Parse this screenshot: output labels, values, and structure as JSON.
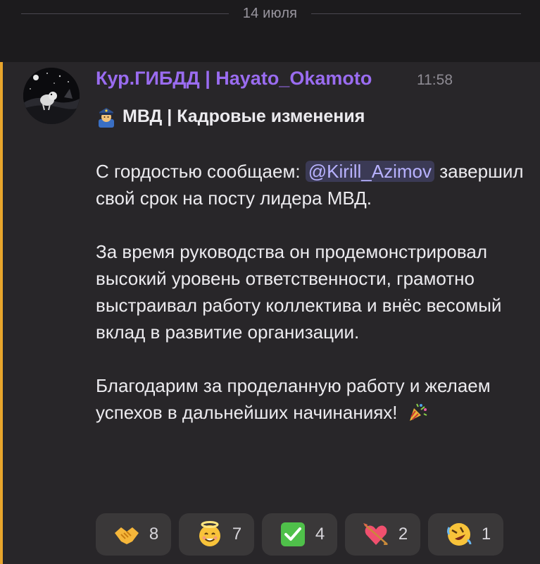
{
  "date_separator": "14 июля",
  "message": {
    "author": "Кур.ГИБДД | Hayato_Okamoto",
    "time": "11:58",
    "title": "МВД | Кадровые изменения",
    "title_icon": "police-officer-emoji",
    "p1_before": "С гордостью сообщаем: ",
    "mention": "@Kirill_Azimov",
    "p1_after": " завершил свой срок на посту лидера МВД.",
    "p2": "За время руководства он продемонстрировал высокий уровень ответственности, грамотно выстраивал работу коллектива и внёс весомый вклад в развитие организации.",
    "p3": "Благодарим за проделанную работу и желаем успехов в дальнейших начинаниях!",
    "p3_icon": "party-popper-emoji"
  },
  "reactions": [
    {
      "icon": "handshake-emoji",
      "count": "8"
    },
    {
      "icon": "smiling-face-halo-emoji",
      "count": "7"
    },
    {
      "icon": "check-mark-emoji",
      "count": "4"
    },
    {
      "icon": "heart-arrow-emoji",
      "count": "2"
    },
    {
      "icon": "rofl-emoji",
      "count": "1"
    }
  ],
  "colors": {
    "accent_bar": "#e8a52c",
    "author": "#9a6cf0",
    "mention_bg": "#3b3a55",
    "mention_text": "#b8b2ff"
  }
}
